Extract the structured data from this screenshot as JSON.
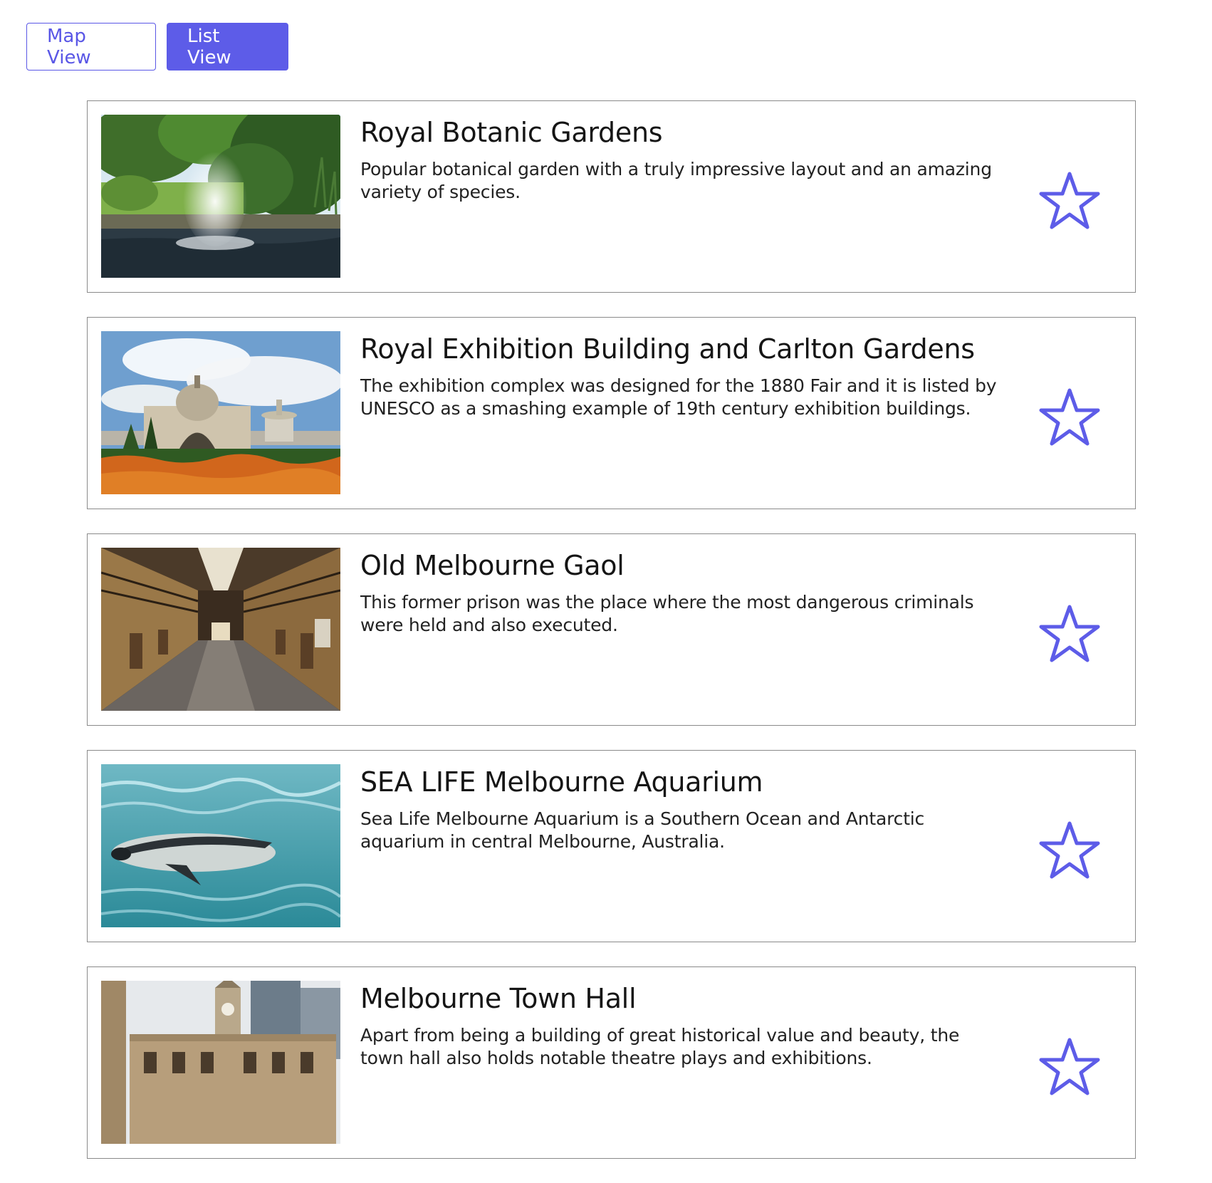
{
  "toolbar": {
    "map_view_label": "Map View",
    "list_view_label": "List View"
  },
  "colors": {
    "accent": "#5d5ce8",
    "card_border": "#8a8a8a"
  },
  "places": [
    {
      "title": "Royal Botanic Gardens",
      "description": "Popular botanical garden with a truly impressive layout and an amazing variety of species.",
      "image_icon": "fountain-garden-photo",
      "favorite_icon": "star-outline-icon"
    },
    {
      "title": "Royal Exhibition Building and Carlton Gardens",
      "description": "The exhibition complex was designed for the 1880 Fair and it is listed by UNESCO as a smashing example of 19th century exhibition buildings.",
      "image_icon": "exhibition-building-photo",
      "favorite_icon": "star-outline-icon"
    },
    {
      "title": "Old Melbourne Gaol",
      "description": "This former prison was the place where the most dangerous criminals were held and also executed.",
      "image_icon": "prison-corridor-photo",
      "favorite_icon": "star-outline-icon"
    },
    {
      "title": "SEA LIFE Melbourne Aquarium",
      "description": "Sea Life Melbourne Aquarium is a Southern Ocean and Antarctic aquarium in central Melbourne, Australia.",
      "image_icon": "penguin-underwater-photo",
      "favorite_icon": "star-outline-icon"
    },
    {
      "title": "Melbourne Town Hall",
      "description": "Apart from being a building of great historical value and beauty, the town hall also holds notable theatre plays and exhibitions.",
      "image_icon": "town-hall-photo",
      "favorite_icon": "star-outline-icon"
    }
  ]
}
